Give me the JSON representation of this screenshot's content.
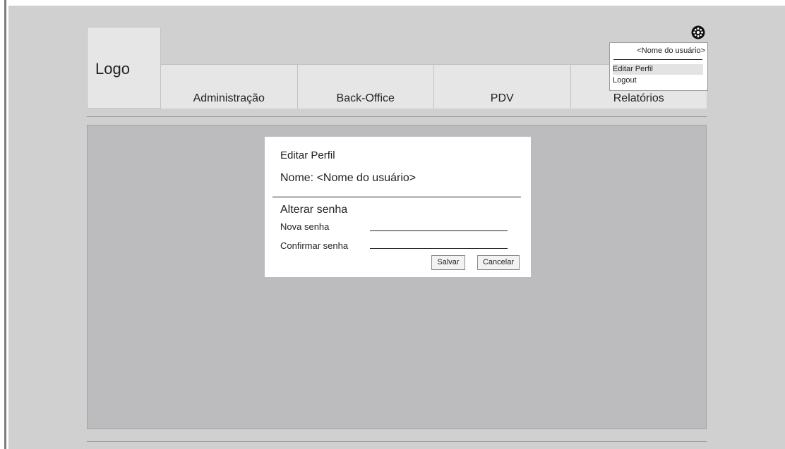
{
  "header": {
    "logo": "Logo",
    "nav": [
      {
        "label": "Administração"
      },
      {
        "label": "Back-Office"
      },
      {
        "label": "PDV"
      },
      {
        "label": "Relatórios"
      }
    ]
  },
  "user_menu": {
    "icon": "gear-icon",
    "user_name": "<Nome do usuário>",
    "items": [
      {
        "label": "Editar Perfil",
        "highlighted": true
      },
      {
        "label": "Logout",
        "highlighted": false
      }
    ]
  },
  "edit_profile": {
    "title": "Editar Perfil",
    "name_label": "Nome:",
    "name_value": "<Nome do usuário>",
    "section_title": "Alterar senha",
    "fields": {
      "new_password": {
        "label": "Nova senha",
        "value": ""
      },
      "confirm_password": {
        "label": "Confirmar senha",
        "value": ""
      }
    },
    "buttons": {
      "save": "Salvar",
      "cancel": "Cancelar"
    }
  },
  "colors": {
    "page_bg": "#d0d0d1",
    "tab_bg": "#e6e6e6",
    "content_bg": "#bcbcbe",
    "dialog_bg": "#ffffff"
  }
}
